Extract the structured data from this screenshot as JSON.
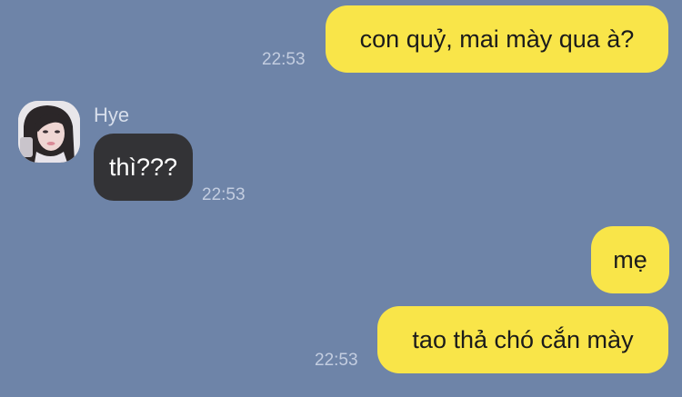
{
  "colors": {
    "background": "#6e84a8",
    "outgoing_bubble": "#f9e549",
    "incoming_bubble": "#333336",
    "timestamp": "#c3cde0"
  },
  "messages": [
    {
      "direction": "outgoing",
      "text": "con quỷ, mai mày qua à?",
      "time": "22:53"
    },
    {
      "direction": "incoming",
      "sender": "Hye",
      "avatar_icon": "profile-photo",
      "text": "thì???",
      "time": "22:53"
    },
    {
      "direction": "outgoing",
      "text": "mẹ"
    },
    {
      "direction": "outgoing",
      "text": "tao thả chó cắn mày",
      "time": "22:53"
    }
  ]
}
